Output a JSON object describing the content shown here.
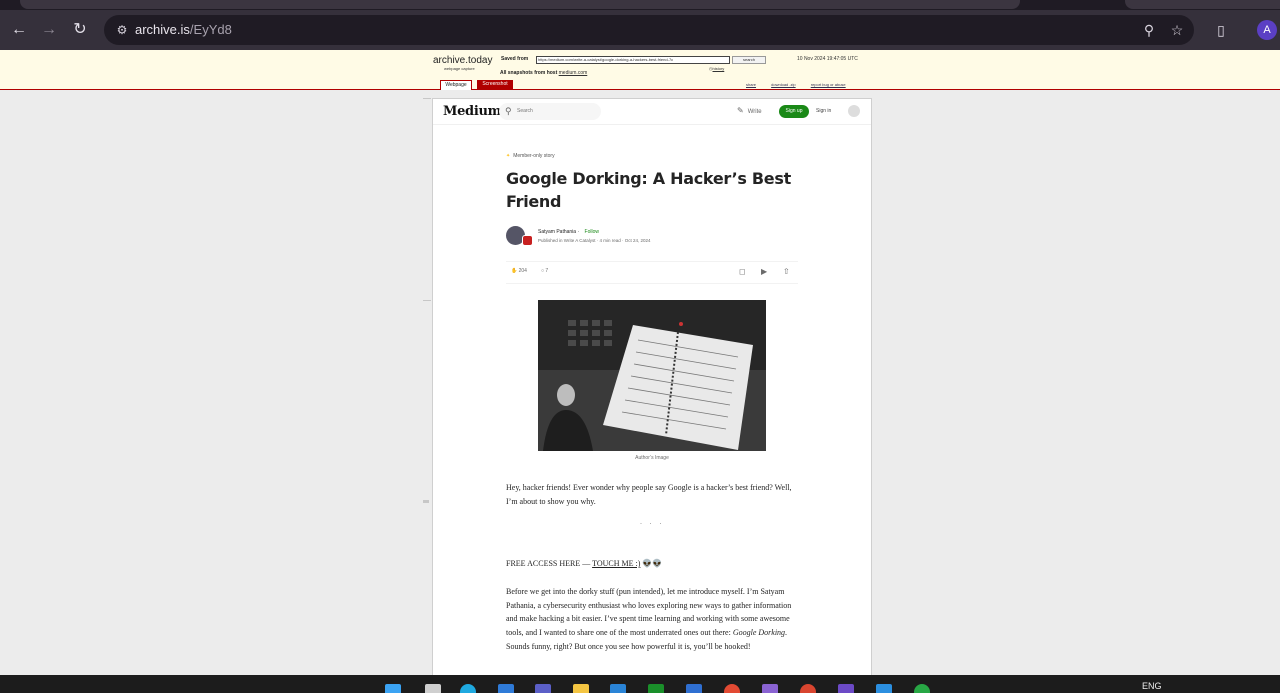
{
  "browser": {
    "url_domain": "archive.is",
    "url_path": "/EyYd8",
    "profile_initial": "A",
    "icons": [
      "back-arrow-icon",
      "forward-arrow-icon",
      "reload-icon",
      "site-settings-icon",
      "zoom-icon",
      "star-icon",
      "extensions-icon"
    ]
  },
  "archive": {
    "logo": "archive.today",
    "logo_sub": "webpage capture",
    "saved_from_label": "Saved from",
    "saved_url": "https://medium.com/write-a-catalyst/google-dorking-a-hackers-best-friend-7c",
    "search_label": "search",
    "date": "10 Nov 2024 19:47:05 UTC",
    "history_label": "history",
    "all_snapshots_label": "All snapshots",
    "from_host_label": "from host",
    "host": "medium.com",
    "tab_webpage": "Webpage",
    "tab_screenshot": "Screenshot",
    "link_share": "share",
    "link_download": "download .zip",
    "link_report": "report bug or abuse"
  },
  "medium": {
    "logo": "Medium",
    "search_placeholder": "Search",
    "write_label": "Write",
    "signup_label": "Sign up",
    "signin_label": "Sign in"
  },
  "article": {
    "member_label": "Member-only story",
    "title": "Google Dorking: A Hacker’s Best Friend",
    "author": "Satyam Pathania",
    "follow_label": "Follow",
    "published_prefix": "Published in",
    "publication": "Write A Catalyst",
    "read_time": "4 min read",
    "date": "Oct 24, 2024",
    "claps": "204",
    "responses": "7",
    "caption": "Author’s Image",
    "paragraph1": "Hey, hacker friends! Ever wonder why people say Google is a hacker’s best friend? Well, I’m about to show you why.",
    "separator": "· · ·",
    "free_access_prefix": "FREE ACCESS HERE — ",
    "free_access_link": "TOUCH ME :)",
    "free_access_suffix": " 👽👽",
    "paragraph2_a": "Before we get into the dorky stuff (pun intended), let me introduce myself. I’m Satyam Pathania, a cybersecurity enthusiast who loves exploring new ways to gather information and make hacking a bit easier. I’ve spent time learning and working with some awesome tools, and I wanted to share one of the most underrated ones out there: ",
    "paragraph2_em": "Google Dorking",
    "paragraph2_b": ". Sounds funny, right? But once you see how powerful it is, you’ll be hooked!"
  },
  "taskbar": {
    "language": "ENG"
  }
}
